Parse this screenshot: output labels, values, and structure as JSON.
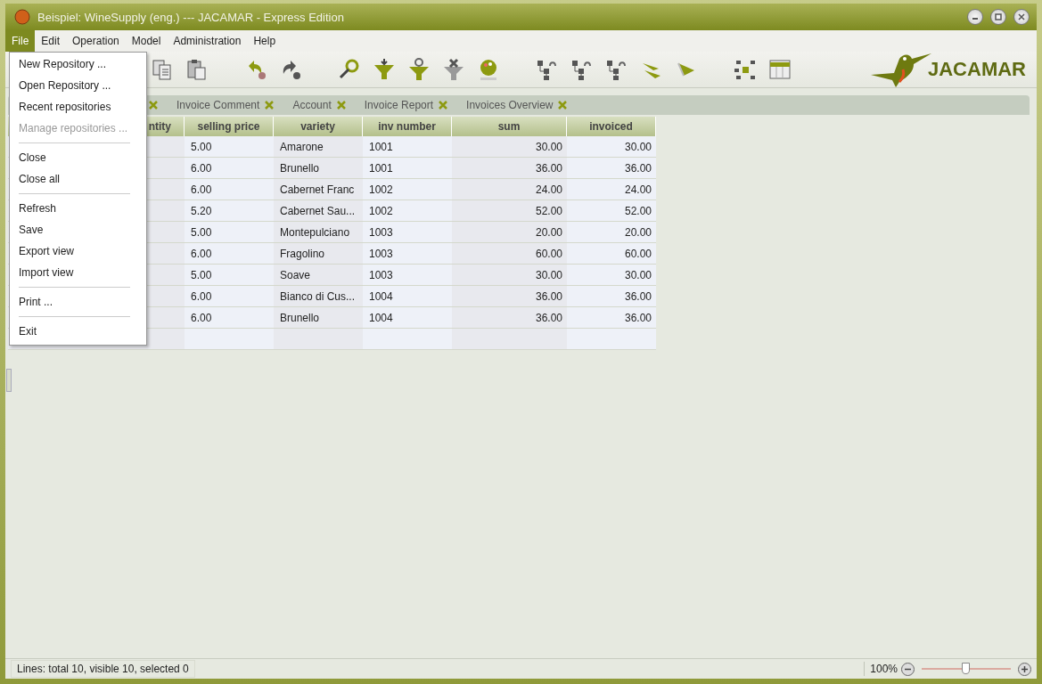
{
  "window": {
    "title": "Beispiel: WineSupply (eng.) --- JACAMAR - Express Edition"
  },
  "menubar": [
    {
      "label": "File",
      "selected": true
    },
    {
      "label": "Edit",
      "selected": false
    },
    {
      "label": "Operation",
      "selected": false
    },
    {
      "label": "Model",
      "selected": false
    },
    {
      "label": "Administration",
      "selected": false
    },
    {
      "label": "Help",
      "selected": false
    }
  ],
  "file_menu": [
    {
      "kind": "item",
      "label": "New Repository ...",
      "disabled": false
    },
    {
      "kind": "item",
      "label": "Open Repository ...",
      "disabled": false
    },
    {
      "kind": "item",
      "label": "Recent repositories",
      "disabled": false
    },
    {
      "kind": "item",
      "label": "Manage repositories ...",
      "disabled": true
    },
    {
      "kind": "separator"
    },
    {
      "kind": "item",
      "label": "Close",
      "disabled": false
    },
    {
      "kind": "item",
      "label": "Close all",
      "disabled": false
    },
    {
      "kind": "separator"
    },
    {
      "kind": "item",
      "label": "Refresh",
      "disabled": false
    },
    {
      "kind": "item",
      "label": "Save",
      "disabled": false
    },
    {
      "kind": "item",
      "label": "Export view",
      "disabled": false
    },
    {
      "kind": "item",
      "label": "Import view",
      "disabled": false
    },
    {
      "kind": "separator"
    },
    {
      "kind": "item",
      "label": "Print ...",
      "disabled": false
    },
    {
      "kind": "separator"
    },
    {
      "kind": "item",
      "label": "Exit",
      "disabled": false
    }
  ],
  "toolbar": [
    {
      "kind": "copy"
    },
    {
      "kind": "paste"
    },
    {
      "kind": "gap"
    },
    {
      "kind": "undo"
    },
    {
      "kind": "redo"
    },
    {
      "kind": "gap"
    },
    {
      "kind": "search"
    },
    {
      "kind": "filter-down"
    },
    {
      "kind": "filter-refresh"
    },
    {
      "kind": "filter-clear"
    },
    {
      "kind": "palette"
    },
    {
      "kind": "gap"
    },
    {
      "kind": "tree-up"
    },
    {
      "kind": "tree-back"
    },
    {
      "kind": "tree-list"
    },
    {
      "kind": "arrow-down"
    },
    {
      "kind": "arrow-right"
    },
    {
      "kind": "gap"
    },
    {
      "kind": "network"
    },
    {
      "kind": "table"
    }
  ],
  "logo": {
    "text": "JACAMAR"
  },
  "tabs": [
    {
      "selected": false
    },
    {
      "label": "Invoice Comment",
      "selected": false
    },
    {
      "label": "Account",
      "selected": false
    },
    {
      "label": "Invoice Report",
      "selected": false
    },
    {
      "label": "Invoices Overview",
      "selected": false
    }
  ],
  "table": {
    "columns": [
      "ntity",
      "selling price",
      "variety",
      "inv number",
      "sum",
      "invoiced"
    ],
    "rows": [
      {
        "cells": [
          "",
          "5.00",
          "Amarone",
          "1001",
          "30.00",
          "30.00"
        ]
      },
      {
        "cells": [
          "",
          "6.00",
          "Brunello",
          "1001",
          "36.00",
          "36.00"
        ]
      },
      {
        "cells": [
          "",
          "6.00",
          "Cabernet Franc",
          "1002",
          "24.00",
          "24.00"
        ]
      },
      {
        "cells": [
          "",
          "5.20",
          "Cabernet Sau...",
          "1002",
          "52.00",
          "52.00"
        ]
      },
      {
        "cells": [
          "",
          "5.00",
          "Montepulciano",
          "1003",
          "20.00",
          "20.00"
        ]
      },
      {
        "cells": [
          "",
          "6.00",
          "Fragolino",
          "1003",
          "60.00",
          "60.00"
        ]
      },
      {
        "cells": [
          "",
          "5.00",
          "Soave",
          "1003",
          "30.00",
          "30.00"
        ]
      },
      {
        "cells": [
          "",
          "6.00",
          "Bianco di Cus...",
          "1004",
          "36.00",
          "36.00"
        ]
      },
      {
        "cells": [
          "",
          "6.00",
          "Brunello",
          "1004",
          "36.00",
          "36.00"
        ]
      },
      {
        "cells": [
          "",
          "",
          "",
          "",
          "",
          ""
        ]
      }
    ]
  },
  "status_bar": {
    "text": "Lines: total 10, visible 10, selected 0",
    "zoom": "100%",
    "zoom_slider": {
      "level": 0.5
    }
  }
}
